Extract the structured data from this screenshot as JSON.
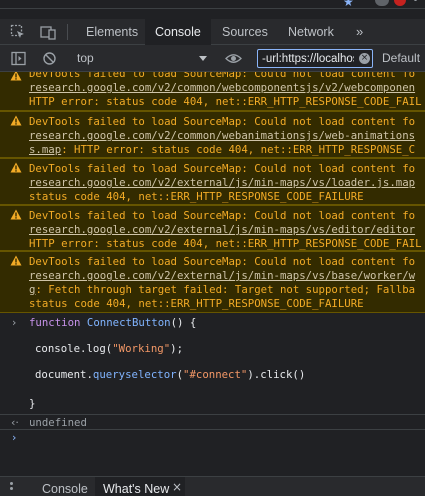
{
  "devtools": {
    "tabs": [
      {
        "label": "Elements"
      },
      {
        "label": "Console",
        "active": true
      },
      {
        "label": "Sources"
      },
      {
        "label": "Network"
      }
    ],
    "more_tabs": "»"
  },
  "toolbar": {
    "context": "top",
    "filter_value": "-url:https://localhost",
    "log_levels": "Default"
  },
  "warnings": [
    {
      "lines": [
        {
          "parts": [
            {
              "t": "plain",
              "v": "DevTools failed to load SourceMap: Could not load content fo"
            }
          ]
        },
        {
          "parts": [
            {
              "t": "lnk",
              "v": "research.google.com/v2/common/webcomponentsjs/v2/webcomponen"
            }
          ]
        },
        {
          "parts": [
            {
              "t": "plain",
              "v": "HTTP error: status code 404, net::ERR_HTTP_RESPONSE_CODE_FAIL"
            }
          ]
        }
      ]
    },
    {
      "lines": [
        {
          "parts": [
            {
              "t": "plain",
              "v": "DevTools failed to load SourceMap: Could not load content fo"
            }
          ]
        },
        {
          "parts": [
            {
              "t": "lnk",
              "v": "research.google.com/v2/common/webanimationsjs/web-animations"
            }
          ]
        },
        {
          "parts": [
            {
              "t": "lnk",
              "v": "s.map"
            },
            {
              "t": "plain",
              "v": ": HTTP error: status code 404, net::ERR_HTTP_RESPONSE_C"
            }
          ]
        }
      ]
    },
    {
      "lines": [
        {
          "parts": [
            {
              "t": "plain",
              "v": "DevTools failed to load SourceMap: Could not load content fo"
            }
          ]
        },
        {
          "parts": [
            {
              "t": "lnk",
              "v": "research.google.com/v2/external/js/min-maps/vs/loader.js.map"
            }
          ]
        },
        {
          "parts": [
            {
              "t": "plain",
              "v": "status code 404, net::ERR_HTTP_RESPONSE_CODE_FAILURE"
            }
          ]
        }
      ]
    },
    {
      "lines": [
        {
          "parts": [
            {
              "t": "plain",
              "v": "DevTools failed to load SourceMap: Could not load content fo"
            }
          ]
        },
        {
          "parts": [
            {
              "t": "lnk",
              "v": "research.google.com/v2/external/js/min-maps/vs/editor/editor"
            }
          ]
        },
        {
          "parts": [
            {
              "t": "plain",
              "v": "HTTP error: status code 404, net::ERR_HTTP_RESPONSE_CODE_FAIL"
            }
          ]
        }
      ]
    },
    {
      "lines": [
        {
          "parts": [
            {
              "t": "plain",
              "v": "DevTools failed to load SourceMap: Could not load content fo"
            }
          ]
        },
        {
          "parts": [
            {
              "t": "lnk",
              "v": "research.google.com/v2/external/js/min-maps/vs/base/worker/w"
            }
          ]
        },
        {
          "parts": [
            {
              "t": "lnk",
              "v": "g"
            },
            {
              "t": "plain",
              "v": ": Fetch through target failed: Target not supported; Fallba"
            }
          ]
        },
        {
          "parts": [
            {
              "t": "plain",
              "v": "status code 404, net::ERR_HTTP_RESPONSE_CODE_FAILURE"
            }
          ]
        }
      ]
    }
  ],
  "code": {
    "line1": {
      "kw": "function",
      "fn": "ConnectButton",
      "rest": "() {"
    },
    "line2": {
      "obj": "console",
      "dot": ".",
      "meth": "log",
      "open": "(",
      "str": "\"Working\"",
      "close": ");"
    },
    "line3": {
      "obj": "document",
      "dot": ".",
      "meth": "queryselector",
      "open": "(",
      "str": "\"#connect\"",
      "close": ").click()"
    },
    "line4": "}"
  },
  "result": "undefined",
  "drawer": {
    "tabs": [
      {
        "label": "Console"
      },
      {
        "label": "What's New",
        "active": true
      }
    ],
    "close_glyph": "×"
  }
}
